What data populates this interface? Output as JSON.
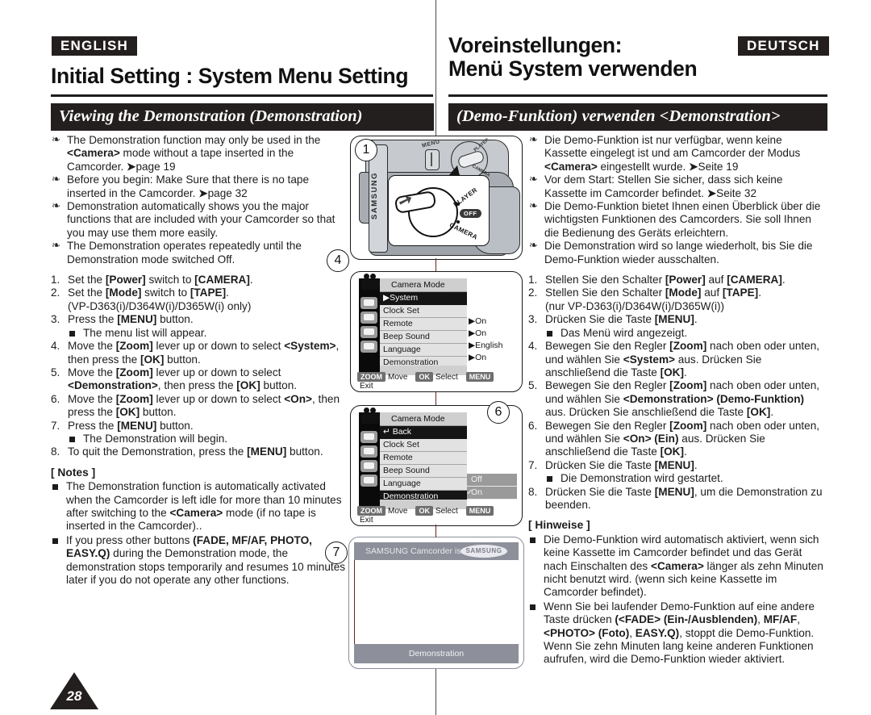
{
  "left": {
    "language_tag": "ENGLISH",
    "chapter_title": "Initial Setting : System Menu Setting",
    "section_title": "Viewing the Demonstration (Demonstration)",
    "bullets": [
      "The Demonstration function may only be used in the <Camera> mode without a tape inserted in the Camcorder. ➔page 19",
      "Before you begin: Make Sure that there is no tape inserted in the Camcorder. ➔page 32",
      "Demonstration automatically shows you the major functions that are included with your Camcorder so that you may use them more easily.",
      "The Demonstration operates repeatedly until the Demonstration mode switched Off."
    ],
    "steps": [
      "Set the [Power] switch to [CAMERA].",
      "Set the [Mode] switch to [TAPE]. (VP-D363(i)/D364W(i)/D365W(i) only)",
      "Press the [MENU] button.",
      "Move the [Zoom] lever up or down to select <System>, then press the [OK] button.",
      "Move the [Zoom] lever up or down to select <Demonstration>, then press the [OK] button.",
      "Move the [Zoom] lever up or down to select <On>, then press the [OK] button.",
      "Press the [MENU] button.",
      "To quit the Demonstration, press the [MENU] button."
    ],
    "substep_3": "The menu list will appear.",
    "substep_7": "The Demonstration will begin.",
    "notes_title": "[ Notes ]",
    "notes": [
      "The Demonstration function is automatically activated when the Camcorder is left idle for more than 10 minutes after switching to the <Camera> mode (if no tape is inserted in the Camcorder)..",
      "If you press other buttons (FADE, MF/AF, PHOTO, EASY.Q) during the Demonstration mode, the demonstration stops temporarily and resumes 10 minutes later if you do not operate any other functions."
    ],
    "page_number": "28"
  },
  "right": {
    "language_tag": "DEUTSCH",
    "chapter_title_line1": "Voreinstellungen:",
    "chapter_title_line2": "Menü System verwenden",
    "section_title": "(Demo-Funktion) verwenden <Demonstration>",
    "bullets": [
      "Die Demo-Funktion ist nur verfügbar, wenn keine Kassette eingelegt ist und am Camcorder der Modus <Camera> eingestellt wurde. ➔Seite 19",
      "Vor dem Start: Stellen Sie sicher, dass sich keine Kassette im Camcorder befindet. ➔Seite 32",
      "Die Demo-Funktion bietet Ihnen einen Überblick über die wichtigsten Funktionen des Camcorders. Sie soll Ihnen die Bedienung des Geräts erleichtern.",
      "Die Demonstration wird so lange wiederholt, bis Sie die Demo-Funktion wieder ausschalten."
    ],
    "steps": [
      "Stellen Sie den Schalter [Power] auf [CAMERA].",
      "Stellen Sie den Schalter [Mode] auf [TAPE]. (nur VP-D363(i)/D364W(i)/D365W(i))",
      "Drücken Sie die Taste [MENU].",
      "Bewegen Sie den Regler [Zoom] nach oben oder unten, und wählen Sie <System> aus. Drücken Sie anschließend die Taste [OK].",
      "Bewegen Sie den Regler [Zoom] nach oben oder unten, und wählen Sie <Demonstration> (Demo-Funktion) aus. Drücken Sie anschließend die Taste [OK].",
      "Bewegen Sie den Regler [Zoom] nach oben oder unten, und wählen Sie <On> (Ein) aus. Drücken Sie anschließend die Taste [OK].",
      "Drücken Sie die Taste [MENU].",
      "Drücken Sie die Taste [MENU], um die Demonstration zu beenden."
    ],
    "substep_3": "Das Menü wird angezeigt.",
    "substep_7": "Die Demonstration wird gestartet.",
    "notes_title": "[ Hinweise ]",
    "notes": [
      "Die Demo-Funktion wird automatisch aktiviert, wenn sich keine Kassette im Camcorder befindet und das Gerät nach Einschalten des <Camera> länger als zehn Minuten nicht benutzt wird. (wenn sich keine Kassette im Camcorder befindet).",
      "Wenn Sie bei laufender Demo-Funktion auf eine andere Taste drücken (<FADE> (Ein-/Ausblenden), MF/AF, <PHOTO> (Foto), EASY.Q), stoppt die Demo-Funktion. Wenn Sie zehn Minuten lang keine anderen Funktionen aufrufen, wird die Demo-Funktion wieder aktiviert."
    ]
  },
  "figures": {
    "marker_1": "1",
    "marker_4": "4",
    "marker_6": "6",
    "marker_7": "7",
    "camera": {
      "brand": "SAMSUNG",
      "menu_label": "MENU",
      "dial_player": "PLAYER",
      "dial_off": "OFF",
      "dial_camera": "CAMERA",
      "dial_tick_player": "PLAYER",
      "dial_tick_camera": "CAMERA"
    },
    "lcd1": {
      "mode_title": "Camera Mode",
      "rows": [
        {
          "label": "▶System",
          "value": "",
          "selected": true
        },
        {
          "label": "Clock Set",
          "value": "",
          "selected": false
        },
        {
          "label": "Remote",
          "value": "▶On",
          "selected": false
        },
        {
          "label": "Beep Sound",
          "value": "▶On",
          "selected": false
        },
        {
          "label": "Language",
          "value": "▶English",
          "selected": false
        },
        {
          "label": "Demonstration",
          "value": "▶On",
          "selected": false
        }
      ],
      "legend": [
        {
          "key": "ZOOM",
          "label": "Move"
        },
        {
          "key": "OK",
          "label": "Select"
        },
        {
          "key": "MENU",
          "label": "Exit"
        }
      ]
    },
    "lcd2": {
      "mode_title": "Camera Mode",
      "rows": [
        {
          "label": "↵ Back",
          "value": "",
          "selected": true
        },
        {
          "label": "Clock Set",
          "value": "",
          "selected": false
        },
        {
          "label": "Remote",
          "value": "",
          "selected": false
        },
        {
          "label": "Beep Sound",
          "value": "",
          "selected": false
        },
        {
          "label": "Language",
          "value": "",
          "selected": false
        },
        {
          "label": "Demonstration",
          "value": "",
          "selected": true
        }
      ],
      "submenu": [
        {
          "label": "Off",
          "checked": false
        },
        {
          "label": "On",
          "checked": true
        }
      ],
      "legend": [
        {
          "key": "ZOOM",
          "label": "Move"
        },
        {
          "key": "OK",
          "label": "Select"
        },
        {
          "key": "MENU",
          "label": "Exit"
        }
      ]
    },
    "lcd3": {
      "top_text": "SAMSUNG Camcorder is...",
      "brand_oval": "SAMSUNG",
      "bottom_text": "Demonstration"
    }
  },
  "colors": {
    "ink": "#241f1f",
    "paper": "#ffffff",
    "lcd_selected": "#151515",
    "lcd_row": "#e2e2e2",
    "lcd_header": "#cfcfcf",
    "lcd_key": "#6e6e6e",
    "demo_bar": "#8d8f9a"
  }
}
